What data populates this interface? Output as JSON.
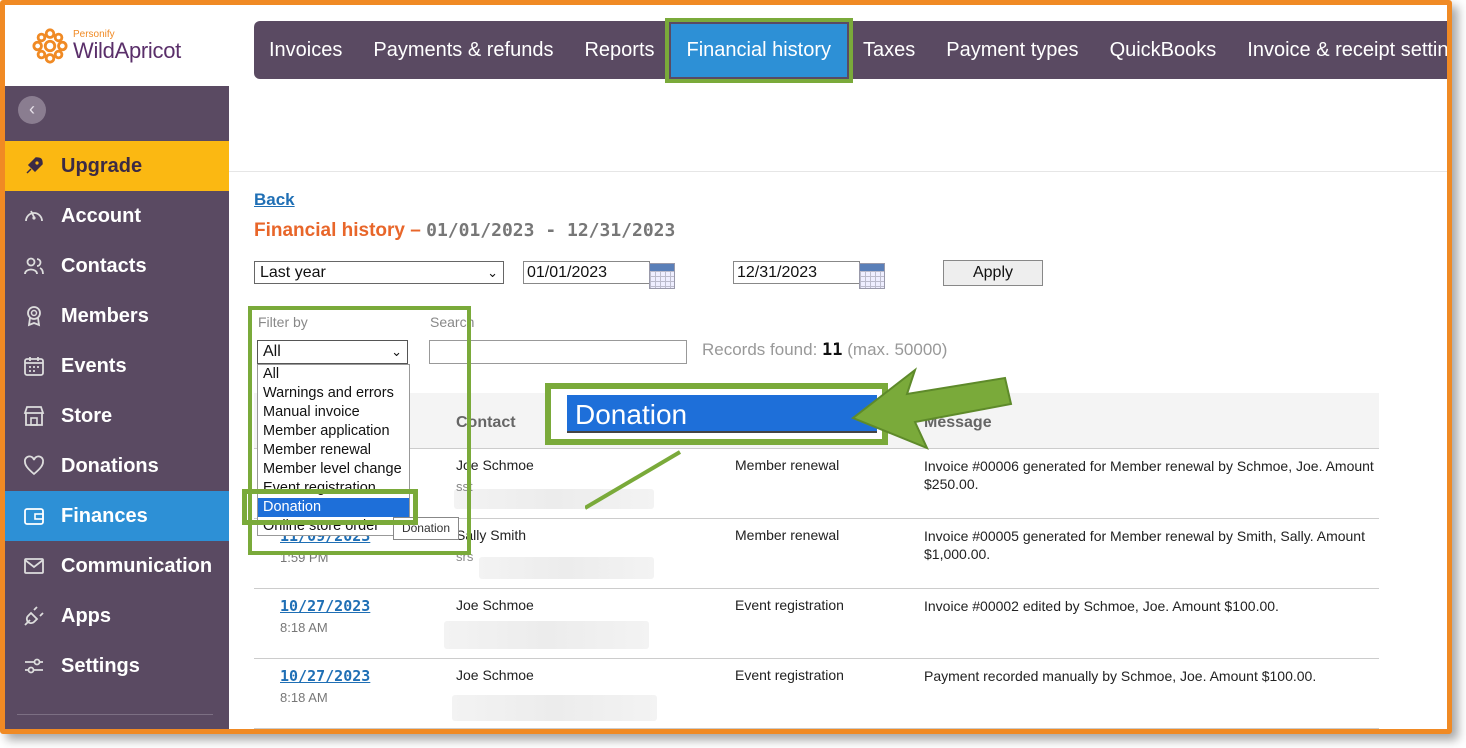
{
  "brand": {
    "small": "Personify",
    "name": "WildApricot"
  },
  "sidebar": {
    "items": [
      {
        "label": "Upgrade",
        "icon": "rocket-icon"
      },
      {
        "label": "Account",
        "icon": "gauge-icon"
      },
      {
        "label": "Contacts",
        "icon": "users-icon"
      },
      {
        "label": "Members",
        "icon": "badge-icon"
      },
      {
        "label": "Events",
        "icon": "calendar-icon"
      },
      {
        "label": "Store",
        "icon": "store-icon"
      },
      {
        "label": "Donations",
        "icon": "heart-icon"
      },
      {
        "label": "Finances",
        "icon": "wallet-icon"
      },
      {
        "label": "Communication",
        "icon": "envelope-icon"
      },
      {
        "label": "Apps",
        "icon": "plug-icon"
      },
      {
        "label": "Settings",
        "icon": "sliders-icon"
      }
    ]
  },
  "tabs": [
    {
      "label": "Invoices"
    },
    {
      "label": "Payments & refunds"
    },
    {
      "label": "Reports"
    },
    {
      "label": "Financial history"
    },
    {
      "label": "Taxes"
    },
    {
      "label": "Payment types"
    },
    {
      "label": "QuickBooks"
    },
    {
      "label": "Invoice & receipt settings"
    }
  ],
  "back": "Back",
  "title": {
    "main": "Financial history –",
    "range": "01/01/2023 - 12/31/2023"
  },
  "period": {
    "selected": "Last year",
    "from": "01/01/2023",
    "to": "12/31/2023",
    "apply": "Apply"
  },
  "filter": {
    "label": "Filter by",
    "selected": "All",
    "options": [
      "All",
      "Warnings and errors",
      "Manual invoice",
      "Member application",
      "Member renewal",
      "Member level change",
      "Event registration",
      "Donation",
      "Online store order"
    ],
    "highlighted": "Donation",
    "tooltip": "Donation"
  },
  "search": {
    "label": "Search",
    "placeholder": ""
  },
  "records": {
    "prefix": "Records found:",
    "count": "11",
    "suffix": "(max. 50000)"
  },
  "zoom_label": "Donation",
  "table": {
    "headers": {
      "contact": "Contact",
      "message": "Message"
    },
    "rows": [
      {
        "date": "",
        "time": "",
        "contact": "Joe Schmoe",
        "sub": "sst",
        "type": "Member renewal",
        "message": "Invoice #00006 generated for Member renewal by Schmoe, Joe. Amount $250.00."
      },
      {
        "date": "11/09/2023",
        "time": "1:59 PM",
        "contact": "Sally Smith",
        "sub": "srs",
        "type": "Member renewal",
        "message": "Invoice #00005 generated for Member renewal by Smith, Sally. Amount $1,000.00."
      },
      {
        "date": "10/27/2023",
        "time": "8:18 AM",
        "contact": "Joe Schmoe",
        "sub": "",
        "type": "Event registration",
        "message": "Invoice #00002 edited by Schmoe, Joe. Amount $100.00."
      },
      {
        "date": "10/27/2023",
        "time": "8:18 AM",
        "contact": "Joe Schmoe",
        "sub": "",
        "type": "Event registration",
        "message": "Payment recorded manually by Schmoe, Joe. Amount $100.00."
      }
    ]
  },
  "colors": {
    "accent_green": "#7aaa3a",
    "sidebar": "#5a4a62",
    "active_blue": "#2d90d6",
    "upgrade_yellow": "#fbb812",
    "title_orange": "#e8662a",
    "frame_orange": "#f08a24"
  }
}
